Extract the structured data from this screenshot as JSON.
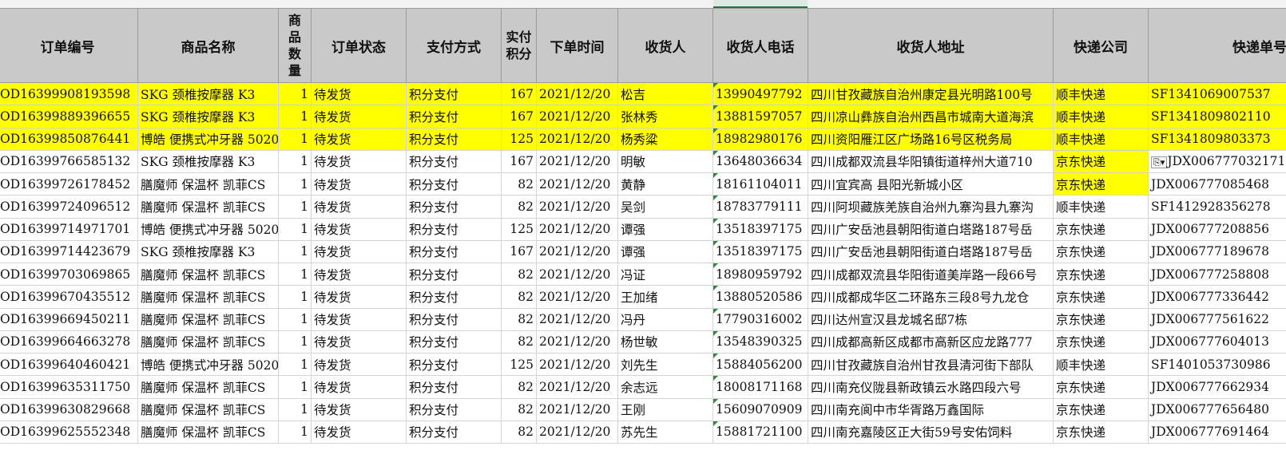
{
  "headers": [
    "订单编号",
    "商品名称",
    "商品数量",
    "订单状态",
    "支付方式",
    "实付积分",
    "下单时间",
    "收货人",
    "收货人电话",
    "收货人地址",
    "快递公司",
    "快递单号"
  ],
  "paste_options_icon": "paste-options-icon",
  "colors": {
    "highlight": "#ffff00",
    "header_bg": "#c9c9c9",
    "selected_accent": "#217346"
  },
  "rows": [
    {
      "id": "OD16399908193598",
      "product": "SKG 颈椎按摩器 K3",
      "qty": "1",
      "status": "待发货",
      "pay": "积分支付",
      "points": "167",
      "date": "2021/12/20",
      "name": "松吉",
      "phone": "13990497792",
      "address": "四川甘孜藏族自治州康定县光明路100号",
      "courier": "顺丰快递",
      "tracking": "SF1341069007537"
    },
    {
      "id": "OD16399889396655",
      "product": "SKG 颈椎按摩器 K3",
      "qty": "1",
      "status": "待发货",
      "pay": "积分支付",
      "points": "167",
      "date": "2021/12/20",
      "name": "张林秀",
      "phone": "13881597057",
      "address": "四川凉山彝族自治州西昌市城南大道海滨",
      "courier": "顺丰快递",
      "tracking": "SF1341809802110"
    },
    {
      "id": "OD16399850876441",
      "product": "博皓 便携式冲牙器 5020",
      "qty": "1",
      "status": "待发货",
      "pay": "积分支付",
      "points": "125",
      "date": "2021/12/20",
      "name": "杨秀粱",
      "phone": "18982980176",
      "address": "四川资阳雁江区广场路16号区税务局",
      "courier": "顺丰快递",
      "tracking": "SF1341809803373"
    },
    {
      "id": "OD16399766585132",
      "product": "SKG 颈椎按摩器 K3",
      "qty": "1",
      "status": "待发货",
      "pay": "积分支付",
      "points": "167",
      "date": "2021/12/20",
      "name": "明敏",
      "phone": "13648036634",
      "address": "四川成都双流县华阳镇街道梓州大道710",
      "courier": "京东快递",
      "tracking": "JDX006777032171"
    },
    {
      "id": "OD16399726178452",
      "product": "膳魔师 保温杯 凯菲CS",
      "qty": "1",
      "status": "待发货",
      "pay": "积分支付",
      "points": "82",
      "date": "2021/12/20",
      "name": "黄静",
      "phone": "18161104011",
      "address": "四川宜宾高   县阳光新城小区",
      "courier": "京东快递",
      "tracking": "JDX006777085468"
    },
    {
      "id": "OD16399724096512",
      "product": "膳魔师 保温杯 凯菲CS",
      "qty": "1",
      "status": "待发货",
      "pay": "积分支付",
      "points": "82",
      "date": "2021/12/20",
      "name": "吴剑",
      "phone": "18783779111",
      "address": "四川阿坝藏族羌族自治州九寨沟县九寨沟",
      "courier": "顺丰快递",
      "tracking": "SF1412928356278"
    },
    {
      "id": "OD16399714971701",
      "product": "博皓 便携式冲牙器 5020",
      "qty": "1",
      "status": "待发货",
      "pay": "积分支付",
      "points": "125",
      "date": "2021/12/20",
      "name": "谭强",
      "phone": "13518397175",
      "address": "四川广安岳池县朝阳街道白塔路187号岳",
      "courier": "京东快递",
      "tracking": "JDX006777208856"
    },
    {
      "id": "OD16399714423679",
      "product": "SKG 颈椎按摩器 K3",
      "qty": "1",
      "status": "待发货",
      "pay": "积分支付",
      "points": "167",
      "date": "2021/12/20",
      "name": "谭强",
      "phone": "13518397175",
      "address": "四川广安岳池县朝阳街道白塔路187号岳",
      "courier": "京东快递",
      "tracking": "JDX006777189678"
    },
    {
      "id": "OD16399703069865",
      "product": "膳魔师 保温杯 凯菲CS",
      "qty": "1",
      "status": "待发货",
      "pay": "积分支付",
      "points": "82",
      "date": "2021/12/20",
      "name": "冯证",
      "phone": "18980959792",
      "address": "四川成都双流县华阳街道美岸路一段66号",
      "courier": "京东快递",
      "tracking": "JDX006777258808"
    },
    {
      "id": "OD16399670435512",
      "product": "膳魔师 保温杯 凯菲CS",
      "qty": "1",
      "status": "待发货",
      "pay": "积分支付",
      "points": "82",
      "date": "2021/12/20",
      "name": "王加绪",
      "phone": "13880520586",
      "address": "四川成都成华区二环路东三段8号九龙仓",
      "courier": "京东快递",
      "tracking": "JDX006777336442"
    },
    {
      "id": "OD16399669450211",
      "product": "膳魔师 保温杯 凯菲CS",
      "qty": "1",
      "status": "待发货",
      "pay": "积分支付",
      "points": "82",
      "date": "2021/12/20",
      "name": "冯丹",
      "phone": "17790316002",
      "address": "四川达州宣汉县龙城名邸7栋",
      "courier": "京东快递",
      "tracking": "JDX006777561622"
    },
    {
      "id": "OD16399664663278",
      "product": "膳魔师 保温杯 凯菲CS",
      "qty": "1",
      "status": "待发货",
      "pay": "积分支付",
      "points": "82",
      "date": "2021/12/20",
      "name": "杨世敏",
      "phone": "13548390325",
      "address": "四川成都高新区成都市高新区应龙路777",
      "courier": "京东快递",
      "tracking": "JDX006777604013"
    },
    {
      "id": "OD16399640460421",
      "product": "博皓 便携式冲牙器 5020",
      "qty": "1",
      "status": "待发货",
      "pay": "积分支付",
      "points": "125",
      "date": "2021/12/20",
      "name": "刘先生",
      "phone": "15884056200",
      "address": "四川甘孜藏族自治州甘孜县清河街下部队",
      "courier": "顺丰快递",
      "tracking": "SF1401053730986"
    },
    {
      "id": "OD16399635311750",
      "product": "膳魔师 保温杯 凯菲CS",
      "qty": "1",
      "status": "待发货",
      "pay": "积分支付",
      "points": "82",
      "date": "2021/12/20",
      "name": "余志远",
      "phone": "18008171168",
      "address": "四川南充仪陇县新政镇云水路四段六号",
      "courier": "京东快递",
      "tracking": "JDX006777662934"
    },
    {
      "id": "OD16399630829668",
      "product": "膳魔师 保温杯 凯菲CS",
      "qty": "1",
      "status": "待发货",
      "pay": "积分支付",
      "points": "82",
      "date": "2021/12/20",
      "name": "王刚",
      "phone": "15609070909",
      "address": "四川南充阆中市华胥路万鑫国际",
      "courier": "京东快递",
      "tracking": "JDX006777656480"
    },
    {
      "id": "OD16399625552348",
      "product": "膳魔师 保温杯 凯菲CS",
      "qty": "1",
      "status": "待发货",
      "pay": "积分支付",
      "points": "82",
      "date": "2021/12/20",
      "name": "苏先生",
      "phone": "15881721100",
      "address": "四川南充嘉陵区正大街59号安佑饲料",
      "courier": "京东快递",
      "tracking": "JDX006777691464"
    }
  ]
}
